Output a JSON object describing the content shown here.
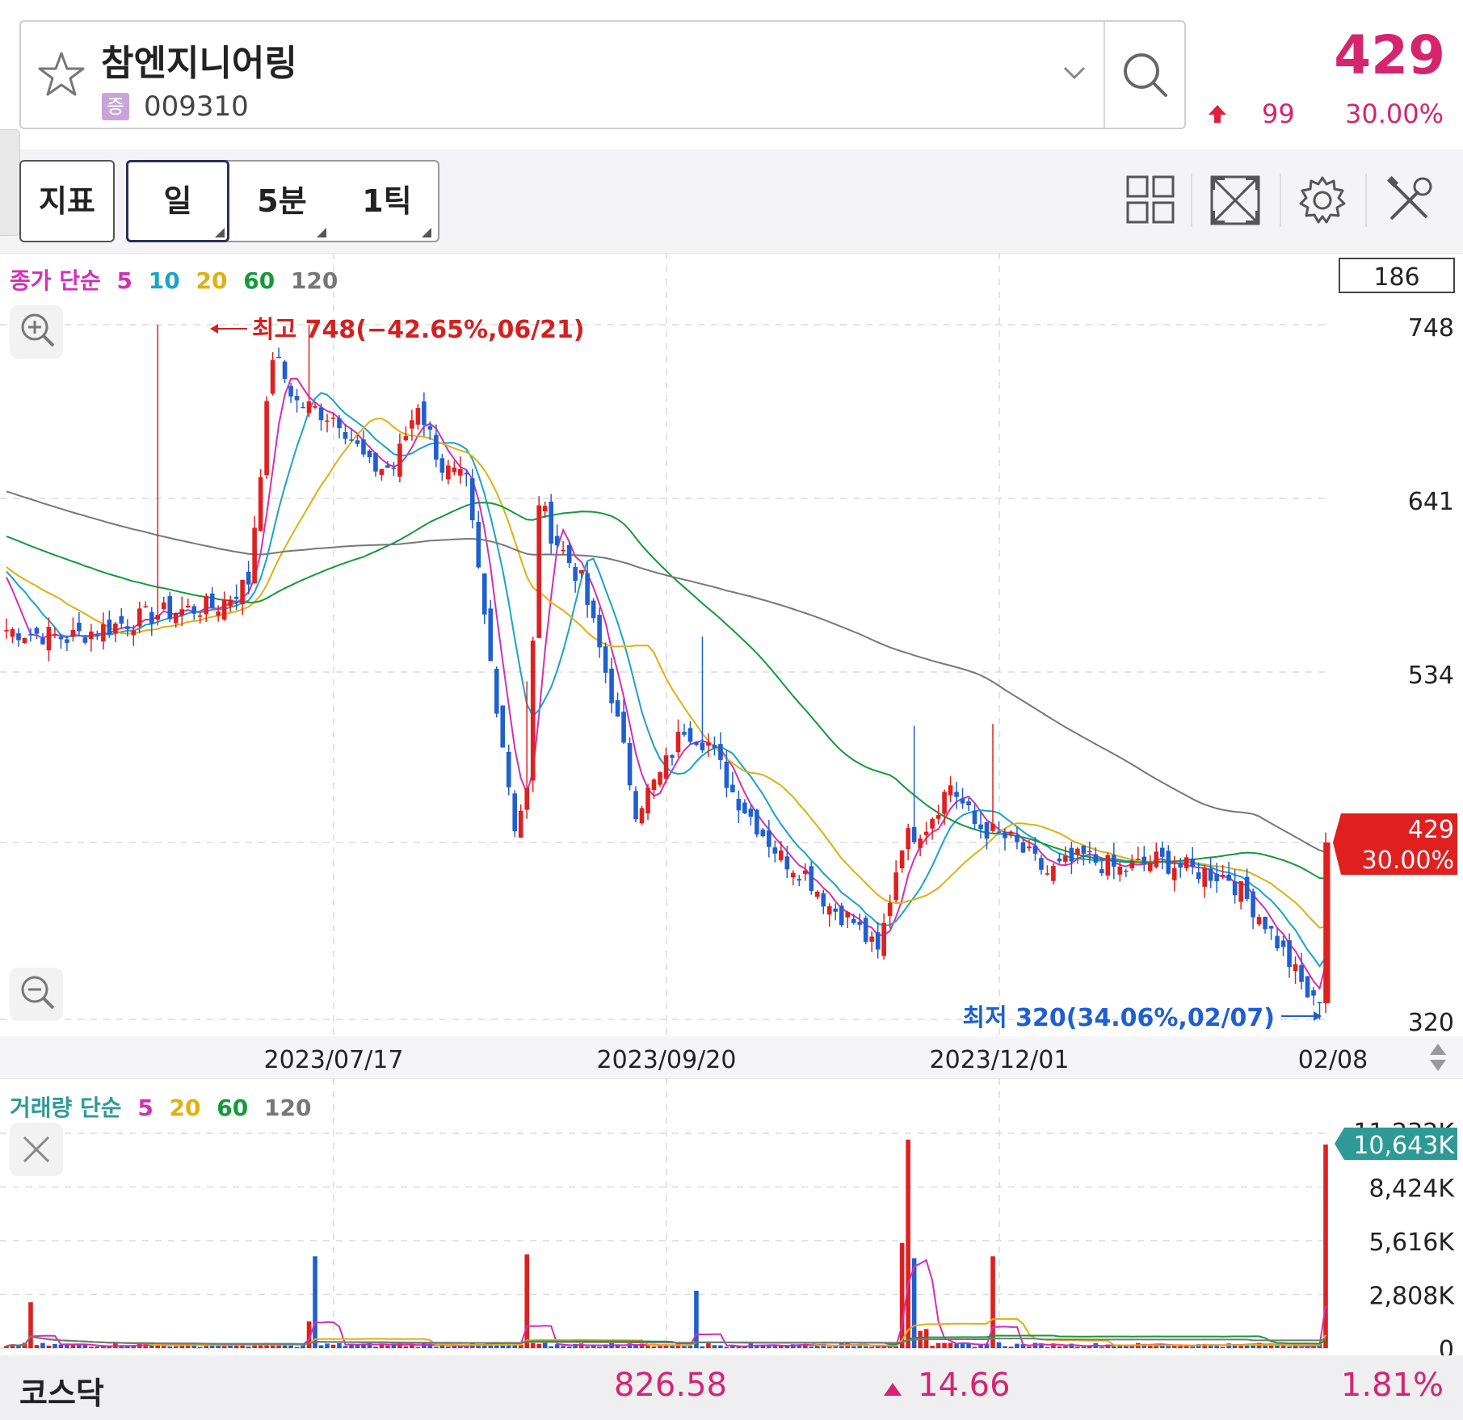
{
  "header": {
    "stock_name": "참엔지니어링",
    "market_badge": "증",
    "stock_code": "009310",
    "price": "429",
    "change": "99",
    "change_pct": "30.00%"
  },
  "toolbar": {
    "indicator_label": "지표",
    "periods": [
      "일",
      "5분",
      "1틱"
    ],
    "selected_period": "일"
  },
  "price_panel": {
    "legend": {
      "prefix": "종가 단순",
      "ma": [
        "5",
        "10",
        "20",
        "60",
        "120"
      ]
    },
    "top_box": "186",
    "high_annotation": "최고 748(−42.65%,06/21)",
    "low_annotation": "최저 320(34.06%,02/07)",
    "current_price_tag": "429",
    "current_pct_tag": "30.00%"
  },
  "volume_panel": {
    "legend": {
      "prefix": "거래량 단순",
      "ma": [
        "5",
        "20",
        "60",
        "120"
      ]
    },
    "current_volume_tag": "10,643K",
    "partial_top_label": "11,232K"
  },
  "footer": {
    "index_name": "코스닥",
    "index_value": "826.58",
    "index_change": "14.66",
    "index_pct": "1.81%"
  },
  "colors": {
    "up": "#e02020",
    "down": "#1f5fd1",
    "accent_pink": "#d6246e",
    "ma5": "#d42fb5",
    "ma10": "#1aa3c8",
    "ma20": "#e0b010",
    "ma60": "#139a3a",
    "ma120": "#777777",
    "volume_tag": "#2e9a96"
  },
  "chart_data": [
    {
      "type": "candlestick",
      "title": "",
      "y_axis_labels": [
        "748",
        "641",
        "534",
        "429",
        "320"
      ],
      "ylim": [
        320,
        748
      ],
      "x_axis_labels": [
        "2023/07/17",
        "2023/09/20",
        "2023/12/01",
        "02/08"
      ],
      "high": {
        "value": 748,
        "date": "06/21"
      },
      "low": {
        "value": 320,
        "date": "02/07"
      },
      "last_close": 429,
      "key_closes": [
        {
          "date": "2023/07/17",
          "close": 680
        },
        {
          "date": "2023/09/20",
          "close": 520
        },
        {
          "date": "2023/12/01",
          "close": 440
        },
        {
          "date": "02/07",
          "close": 330
        },
        {
          "date": "02/08",
          "close": 429
        }
      ],
      "moving_averages": [
        "5",
        "10",
        "20",
        "60",
        "120"
      ]
    },
    {
      "type": "bar",
      "title": "",
      "y_axis_labels": [
        "8,424K",
        "5,616K",
        "2,808K",
        "0"
      ],
      "ylim": [
        0,
        11232
      ],
      "unit": "K",
      "last_volume_k": 10643,
      "moving_averages": [
        "5",
        "20",
        "60",
        "120"
      ]
    }
  ]
}
